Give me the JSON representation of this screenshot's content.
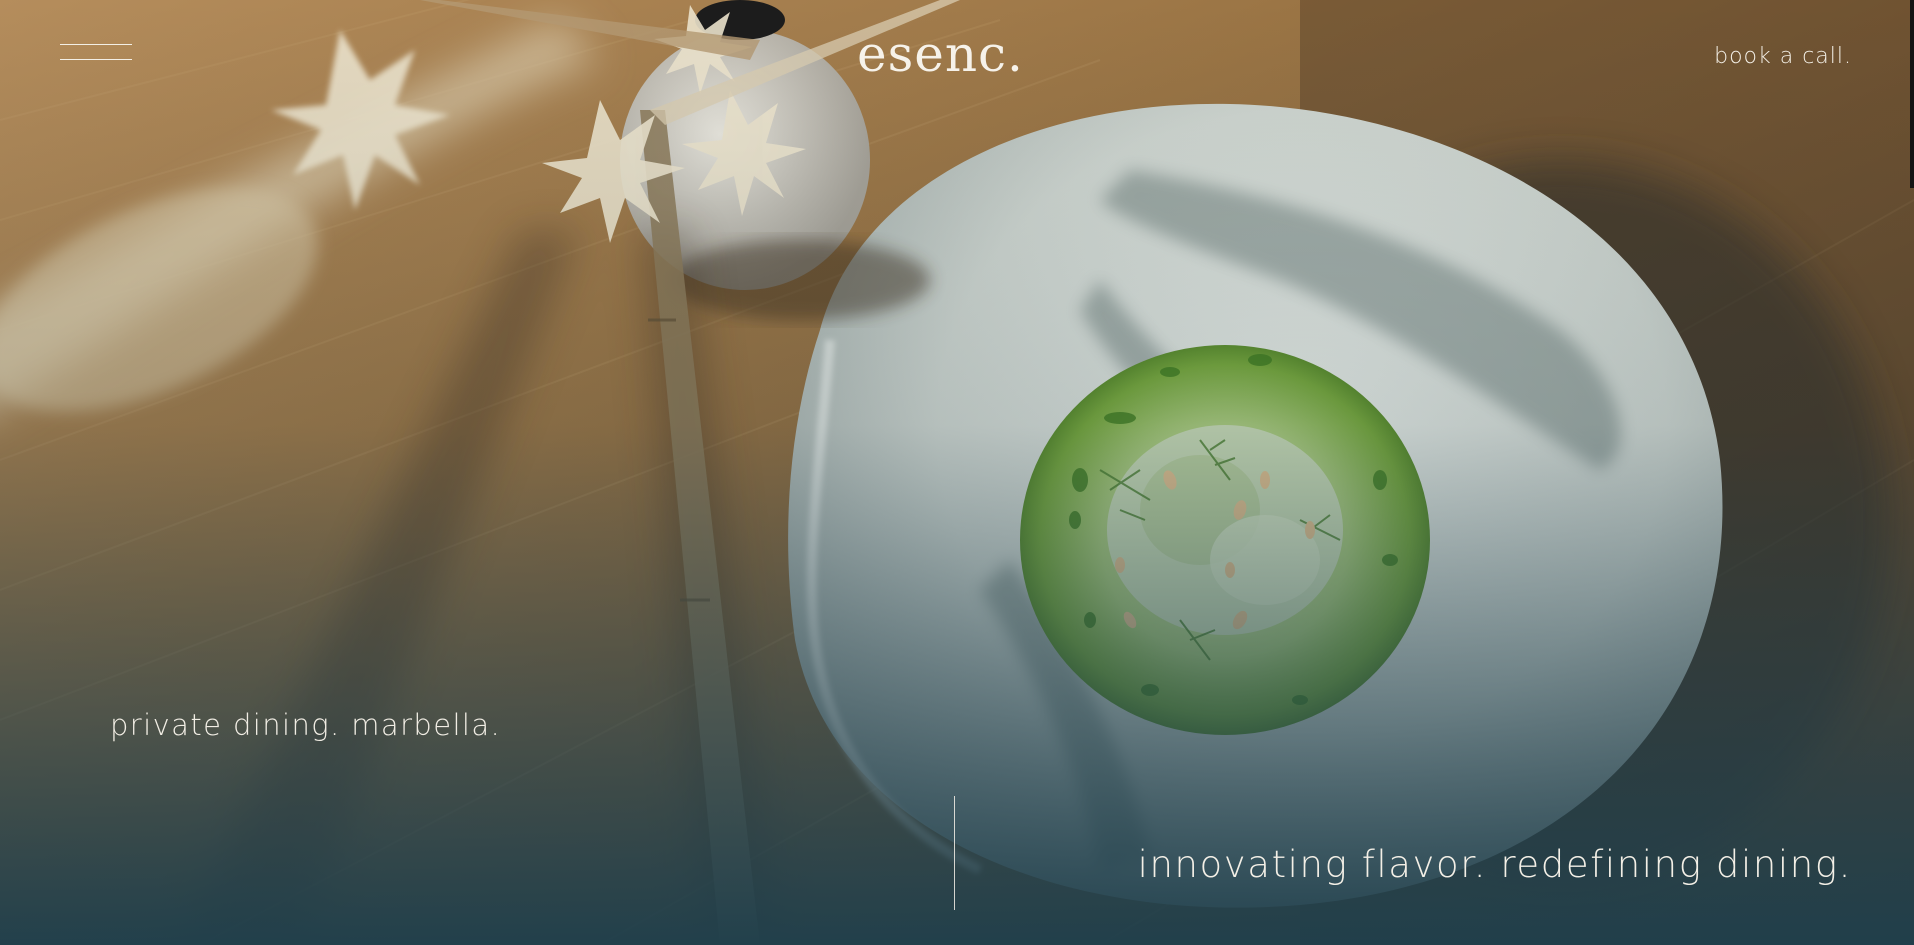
{
  "header": {
    "menu_icon": "hamburger-menu-icon",
    "logo_text": "esenc.",
    "book_call_label": "book a call."
  },
  "hero": {
    "image_description_icon": "plated-dish-photo",
    "tagline_left": "private dining. marbella.",
    "tagline_right": "innovating flavor. redefining dining."
  },
  "colors": {
    "wood": "#a0784a",
    "overlay_teal": "#254654",
    "plate": "#cfd4ce",
    "sauce_green": "#6fa53a",
    "text": "#f3efe6"
  }
}
